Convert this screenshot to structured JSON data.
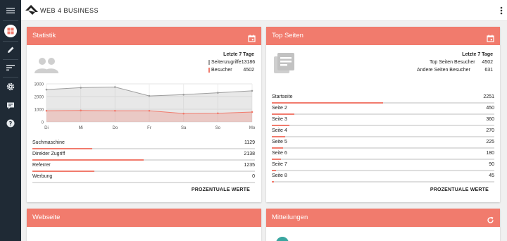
{
  "app": {
    "logo_text": "WEB 4 BUSINESS"
  },
  "colors": {
    "accent": "#f17b6d",
    "rail": "#1f2a35",
    "active_icon": "#f17b6d"
  },
  "sidebar": {
    "items": [
      {
        "icon": "menu-icon"
      },
      {
        "icon": "dashboard-icon",
        "active": true
      },
      {
        "icon": "pencil-icon"
      },
      {
        "icon": "sort-icon"
      },
      {
        "icon": "gear-icon"
      },
      {
        "icon": "chat-icon"
      },
      {
        "icon": "help-icon"
      }
    ]
  },
  "statistik": {
    "title": "Statistik",
    "legend_title": "Letzte 7 Tage",
    "legend": [
      {
        "label": "Seitenzugriffe",
        "value": "13186",
        "color": "#9e9e9e"
      },
      {
        "label": "Besucher",
        "value": "4502",
        "color": "#f17b6d"
      }
    ],
    "sources": [
      {
        "label": "Suchmaschine",
        "value": "1129",
        "fraction": 0.27
      },
      {
        "label": "Direkter Zugriff",
        "value": "2138",
        "fraction": 0.5
      },
      {
        "label": "Referrer",
        "value": "1235",
        "fraction": 0.28
      },
      {
        "label": "Werbung",
        "value": "0",
        "fraction": 0.0
      }
    ],
    "percent_button": "PROZENTUALE WERTE"
  },
  "chart_data": {
    "type": "area",
    "x": [
      "Di",
      "Mi",
      "Do",
      "Fr",
      "Sa",
      "So",
      "Mo"
    ],
    "yticks": [
      "3000",
      "2000",
      "1000",
      "0"
    ],
    "ylim": [
      0,
      3000
    ],
    "series": [
      {
        "name": "Seitenzugriffe",
        "values": [
          2550,
          2700,
          2750,
          2050,
          2150,
          2300,
          2450
        ],
        "color": "#9e9e9e"
      },
      {
        "name": "Besucher",
        "values": [
          880,
          900,
          880,
          880,
          660,
          680,
          780
        ],
        "color": "#f17b6d"
      }
    ],
    "grid": true
  },
  "topseiten": {
    "title": "Top Seiten",
    "legend_title": "Letzte 7 Tage",
    "summary": [
      {
        "label": "Top Seiten Besucher",
        "value": "4502"
      },
      {
        "label": "Andere Seiten Besucher",
        "value": "631"
      }
    ],
    "pages": [
      {
        "label": "Startseite",
        "value": "2251",
        "fraction": 0.5
      },
      {
        "label": "Seite 2",
        "value": "450",
        "fraction": 0.1
      },
      {
        "label": "Seite 3",
        "value": "360",
        "fraction": 0.08
      },
      {
        "label": "Seite 4",
        "value": "270",
        "fraction": 0.06
      },
      {
        "label": "Seite 5",
        "value": "225",
        "fraction": 0.05
      },
      {
        "label": "Seite 6",
        "value": "180",
        "fraction": 0.04
      },
      {
        "label": "Seite 7",
        "value": "90",
        "fraction": 0.02
      },
      {
        "label": "Seite 8",
        "value": "45",
        "fraction": 0.01
      }
    ],
    "percent_button": "PROZENTUALE WERTE"
  },
  "webseite": {
    "title": "Webseite"
  },
  "mitteilungen": {
    "title": "Mitteilungen"
  }
}
